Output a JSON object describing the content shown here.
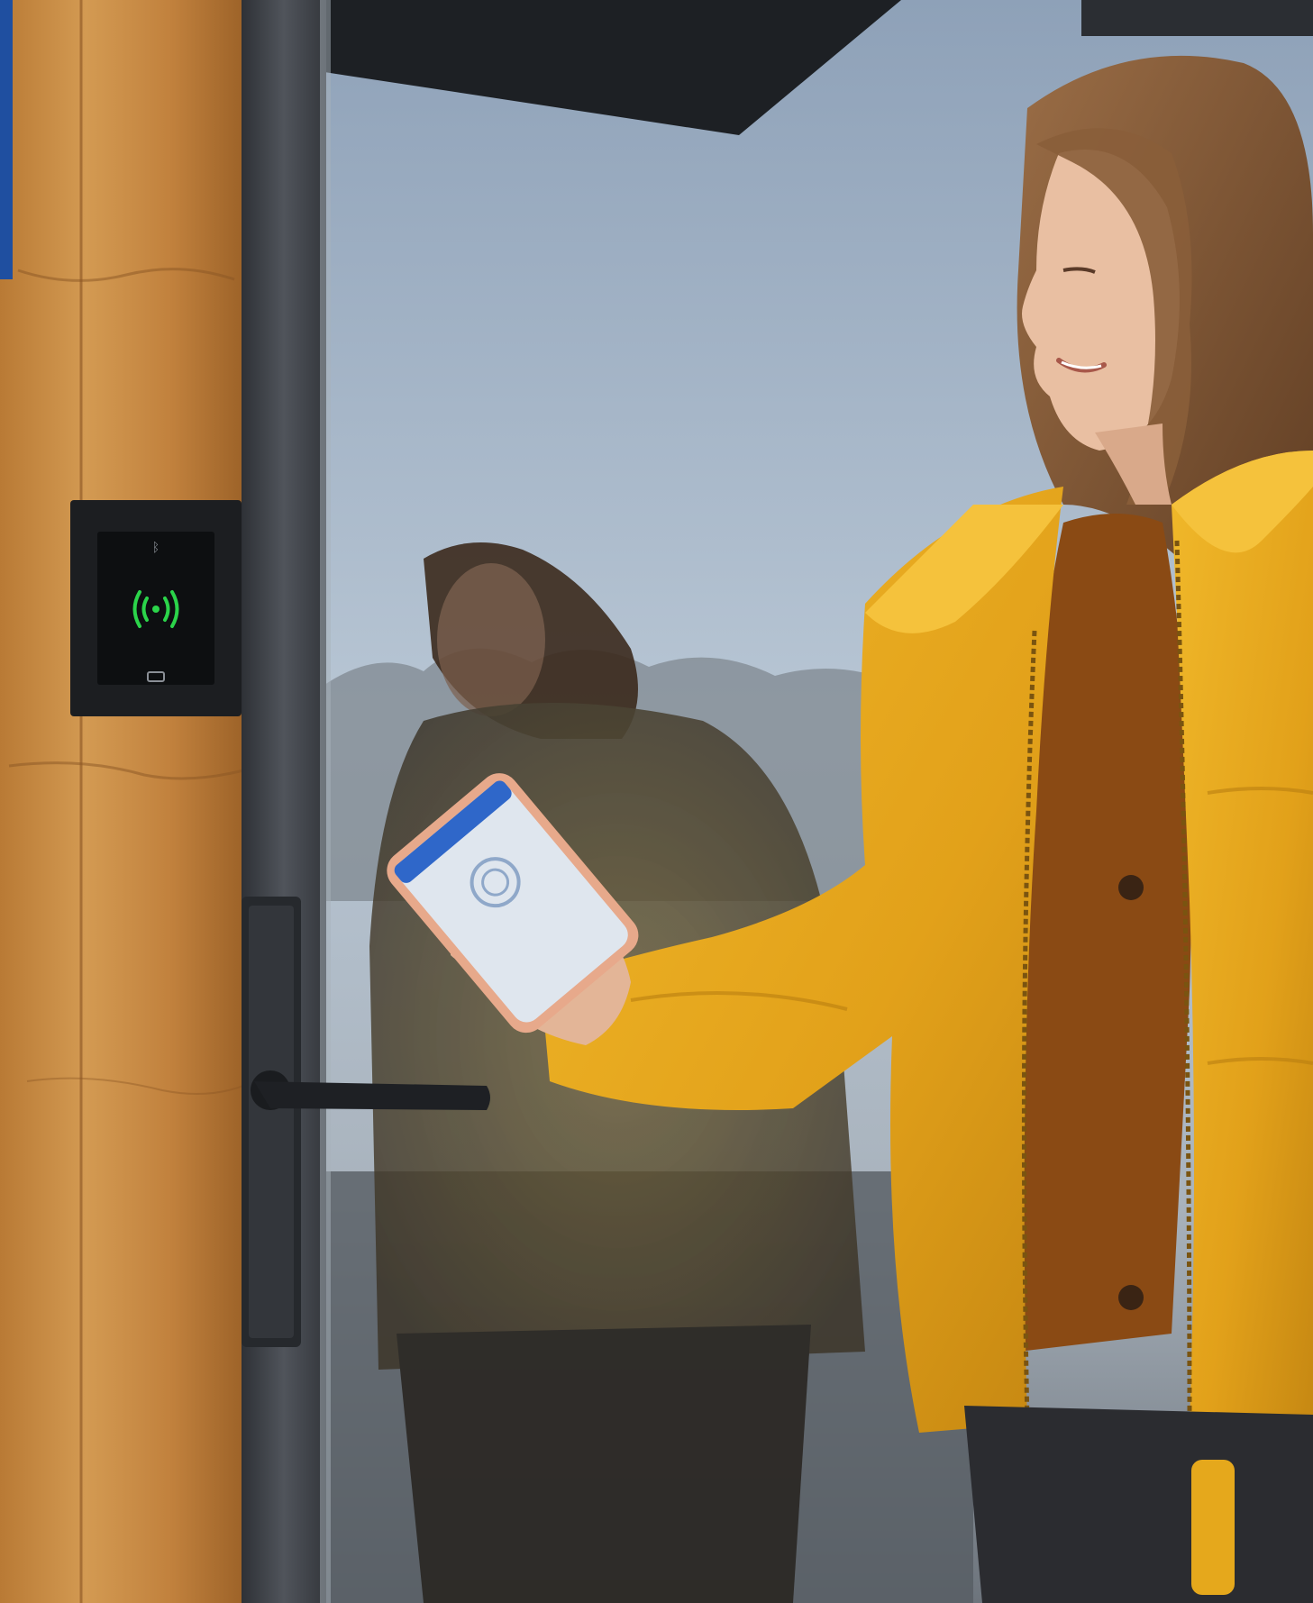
{
  "scene": {
    "description_alt": "",
    "colors": {
      "accent_blue": "#1f4fa0",
      "wood_light": "#c8893f",
      "wood_dark": "#8a5523",
      "door_frame": "#3a3d43",
      "sky_top": "#9fb0c4",
      "sky_bottom": "#c9d3dd",
      "jacket": "#e5a81c",
      "jacket_shadow": "#b97e10",
      "sweater": "#8a4a14",
      "hair": "#7a5234",
      "skin": "#e9bfa2",
      "reader_green": "#2bd44a",
      "phone_screen": "#dfe6ee",
      "phone_header": "#2f67c9"
    },
    "icons": {
      "reader_signal": "nfc-signal-icon",
      "reader_bluetooth": "bluetooth-icon",
      "reader_card": "card-icon"
    }
  }
}
